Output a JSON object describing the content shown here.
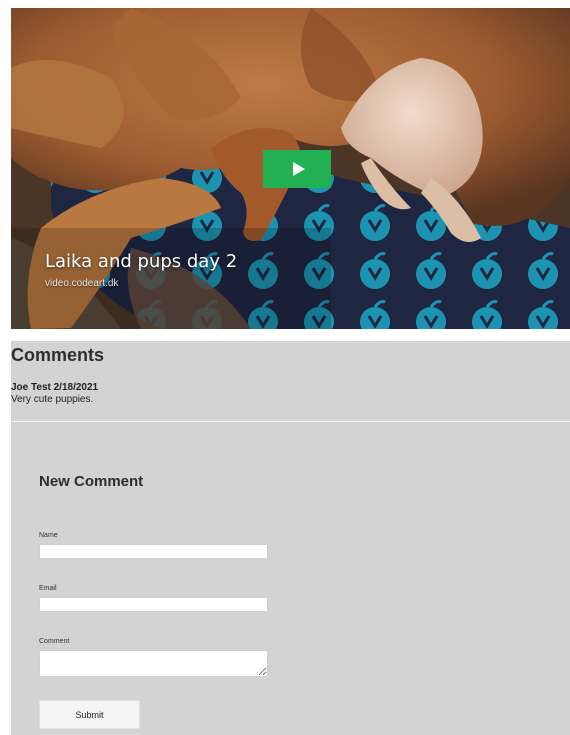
{
  "video": {
    "title": "Laika and pups day 2",
    "source": "video.codeart.dk",
    "play_icon": "play-icon",
    "play_button_color": "#21b152"
  },
  "comments": {
    "heading": "Comments",
    "items": [
      {
        "author_date": "Joe Test 2/18/2021",
        "text": "Very cute puppies."
      }
    ]
  },
  "new_comment": {
    "heading": "New Comment",
    "name_label": "Name",
    "email_label": "Email",
    "comment_label": "Comment",
    "submit_label": "Submit"
  },
  "colors": {
    "panel_background": "#d3d3d3",
    "blanket_teal": "#1f8fae",
    "blanket_navy": "#1d2440"
  }
}
